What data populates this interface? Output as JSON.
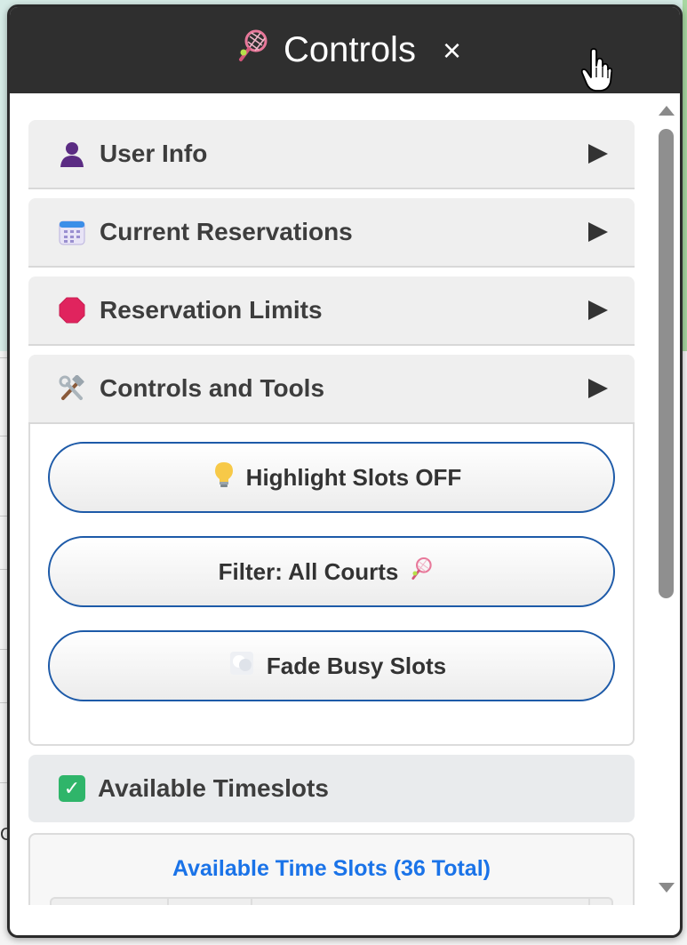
{
  "panel": {
    "title": "Controls",
    "title_icon": "tennis-racket-icon",
    "close_label": "×"
  },
  "sections": [
    {
      "label": "User Info",
      "icon": "user-silhouette-icon",
      "expanded": false
    },
    {
      "label": "Current Reservations",
      "icon": "calendar-icon",
      "expanded": false
    },
    {
      "label": "Reservation Limits",
      "icon": "stop-sign-icon",
      "expanded": false
    },
    {
      "label": "Controls and Tools",
      "icon": "hammer-wrench-icon",
      "expanded": true
    }
  ],
  "tools": {
    "highlight_label": "Highlight Slots OFF",
    "highlight_icon": "light-bulb-icon",
    "filter_label": "Filter: All Courts",
    "filter_icon": "tennis-racket-icon",
    "fade_label": "Fade Busy Slots",
    "fade_icon": "fog-icon"
  },
  "available": {
    "label": "Available Timeslots",
    "icon": "check-mark-icon",
    "slots_title": "Available Time Slots (36 Total)"
  },
  "colors": {
    "header_bg": "#2f2f2f",
    "button_border": "#1d5aa8",
    "slots_title": "#1a73e8",
    "check_green": "#2fb56a"
  }
}
